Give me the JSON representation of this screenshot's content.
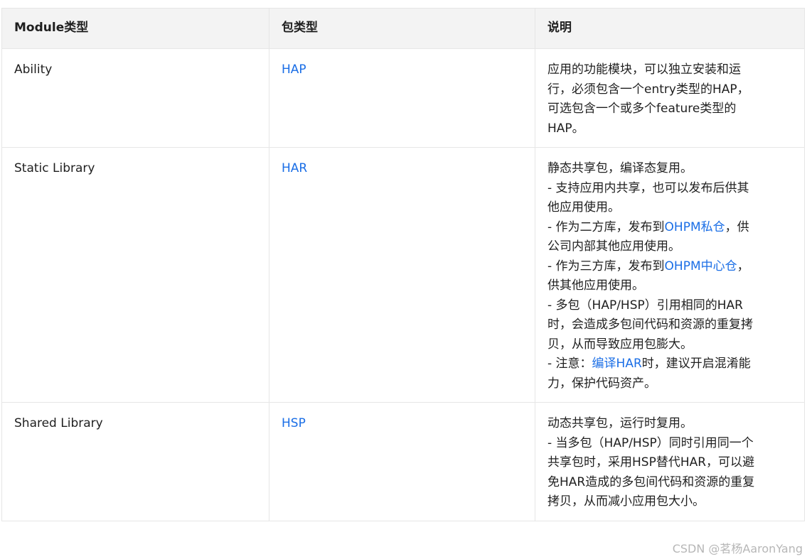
{
  "table": {
    "headers": [
      "Module类型",
      "包类型",
      "说明"
    ],
    "rows": [
      {
        "module_type": "Ability",
        "package_type": "HAP",
        "desc_lines": [
          "应用的功能模块，可以独立安装和运",
          "行，必须包含一个entry类型的HAP，",
          "可选包含一个或多个feature类型的",
          "HAP。"
        ]
      },
      {
        "module_type": "Static Library",
        "package_type": "HAR",
        "desc": {
          "l1": "静态共享包，编译态复用。",
          "l2": "- 支持应用内共享，也可以发布后供其",
          "l3": "他应用使用。",
          "l4_pre": "- 作为二方库，发布到",
          "l4_link": "OHPM私仓",
          "l4_post": "，供",
          "l5": "公司内部其他应用使用。",
          "l6_pre": "- 作为三方库，发布到",
          "l6_link": "OHPM中心仓",
          "l6_post": "，",
          "l7": "供其他应用使用。",
          "l8": "- 多包（HAP/HSP）引用相同的HAR",
          "l9": "时，会造成多包间代码和资源的重复拷",
          "l10": "贝，从而导致应用包膨大。",
          "l11_pre": "- 注意：",
          "l11_link": "编译HAR",
          "l11_post": "时，建议开启混淆能",
          "l12": "力，保护代码资产。"
        }
      },
      {
        "module_type": "Shared Library",
        "package_type": "HSP",
        "desc_lines": [
          "动态共享包，运行时复用。",
          "- 当多包（HAP/HSP）同时引用同一个",
          "共享包时，采用HSP替代HAR，可以避",
          "免HAR造成的多包间代码和资源的重复",
          "拷贝，从而减小应用包大小。"
        ]
      }
    ]
  },
  "watermark": "CSDN @茗杨AaronYang",
  "colors": {
    "link": "#1a6ee6",
    "header_bg": "#f3f3f3",
    "border": "#e6e6e6",
    "text": "#1f1f1f",
    "watermark": "#b7b7b7"
  }
}
